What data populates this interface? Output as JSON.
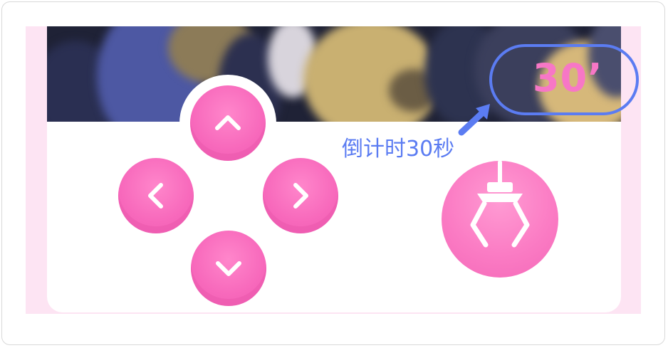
{
  "timer": {
    "value": "30’",
    "caption": "倒计时30秒"
  },
  "controls": {
    "up_icon": "chevron-up-icon",
    "left_icon": "chevron-left-icon",
    "right_icon": "chevron-right-icon",
    "down_icon": "chevron-down-icon",
    "grab_icon": "claw-icon"
  },
  "colors": {
    "button_pink": "#f768bb",
    "accent_blue": "#5b7cf2",
    "panel_pink": "#fde4f3"
  }
}
